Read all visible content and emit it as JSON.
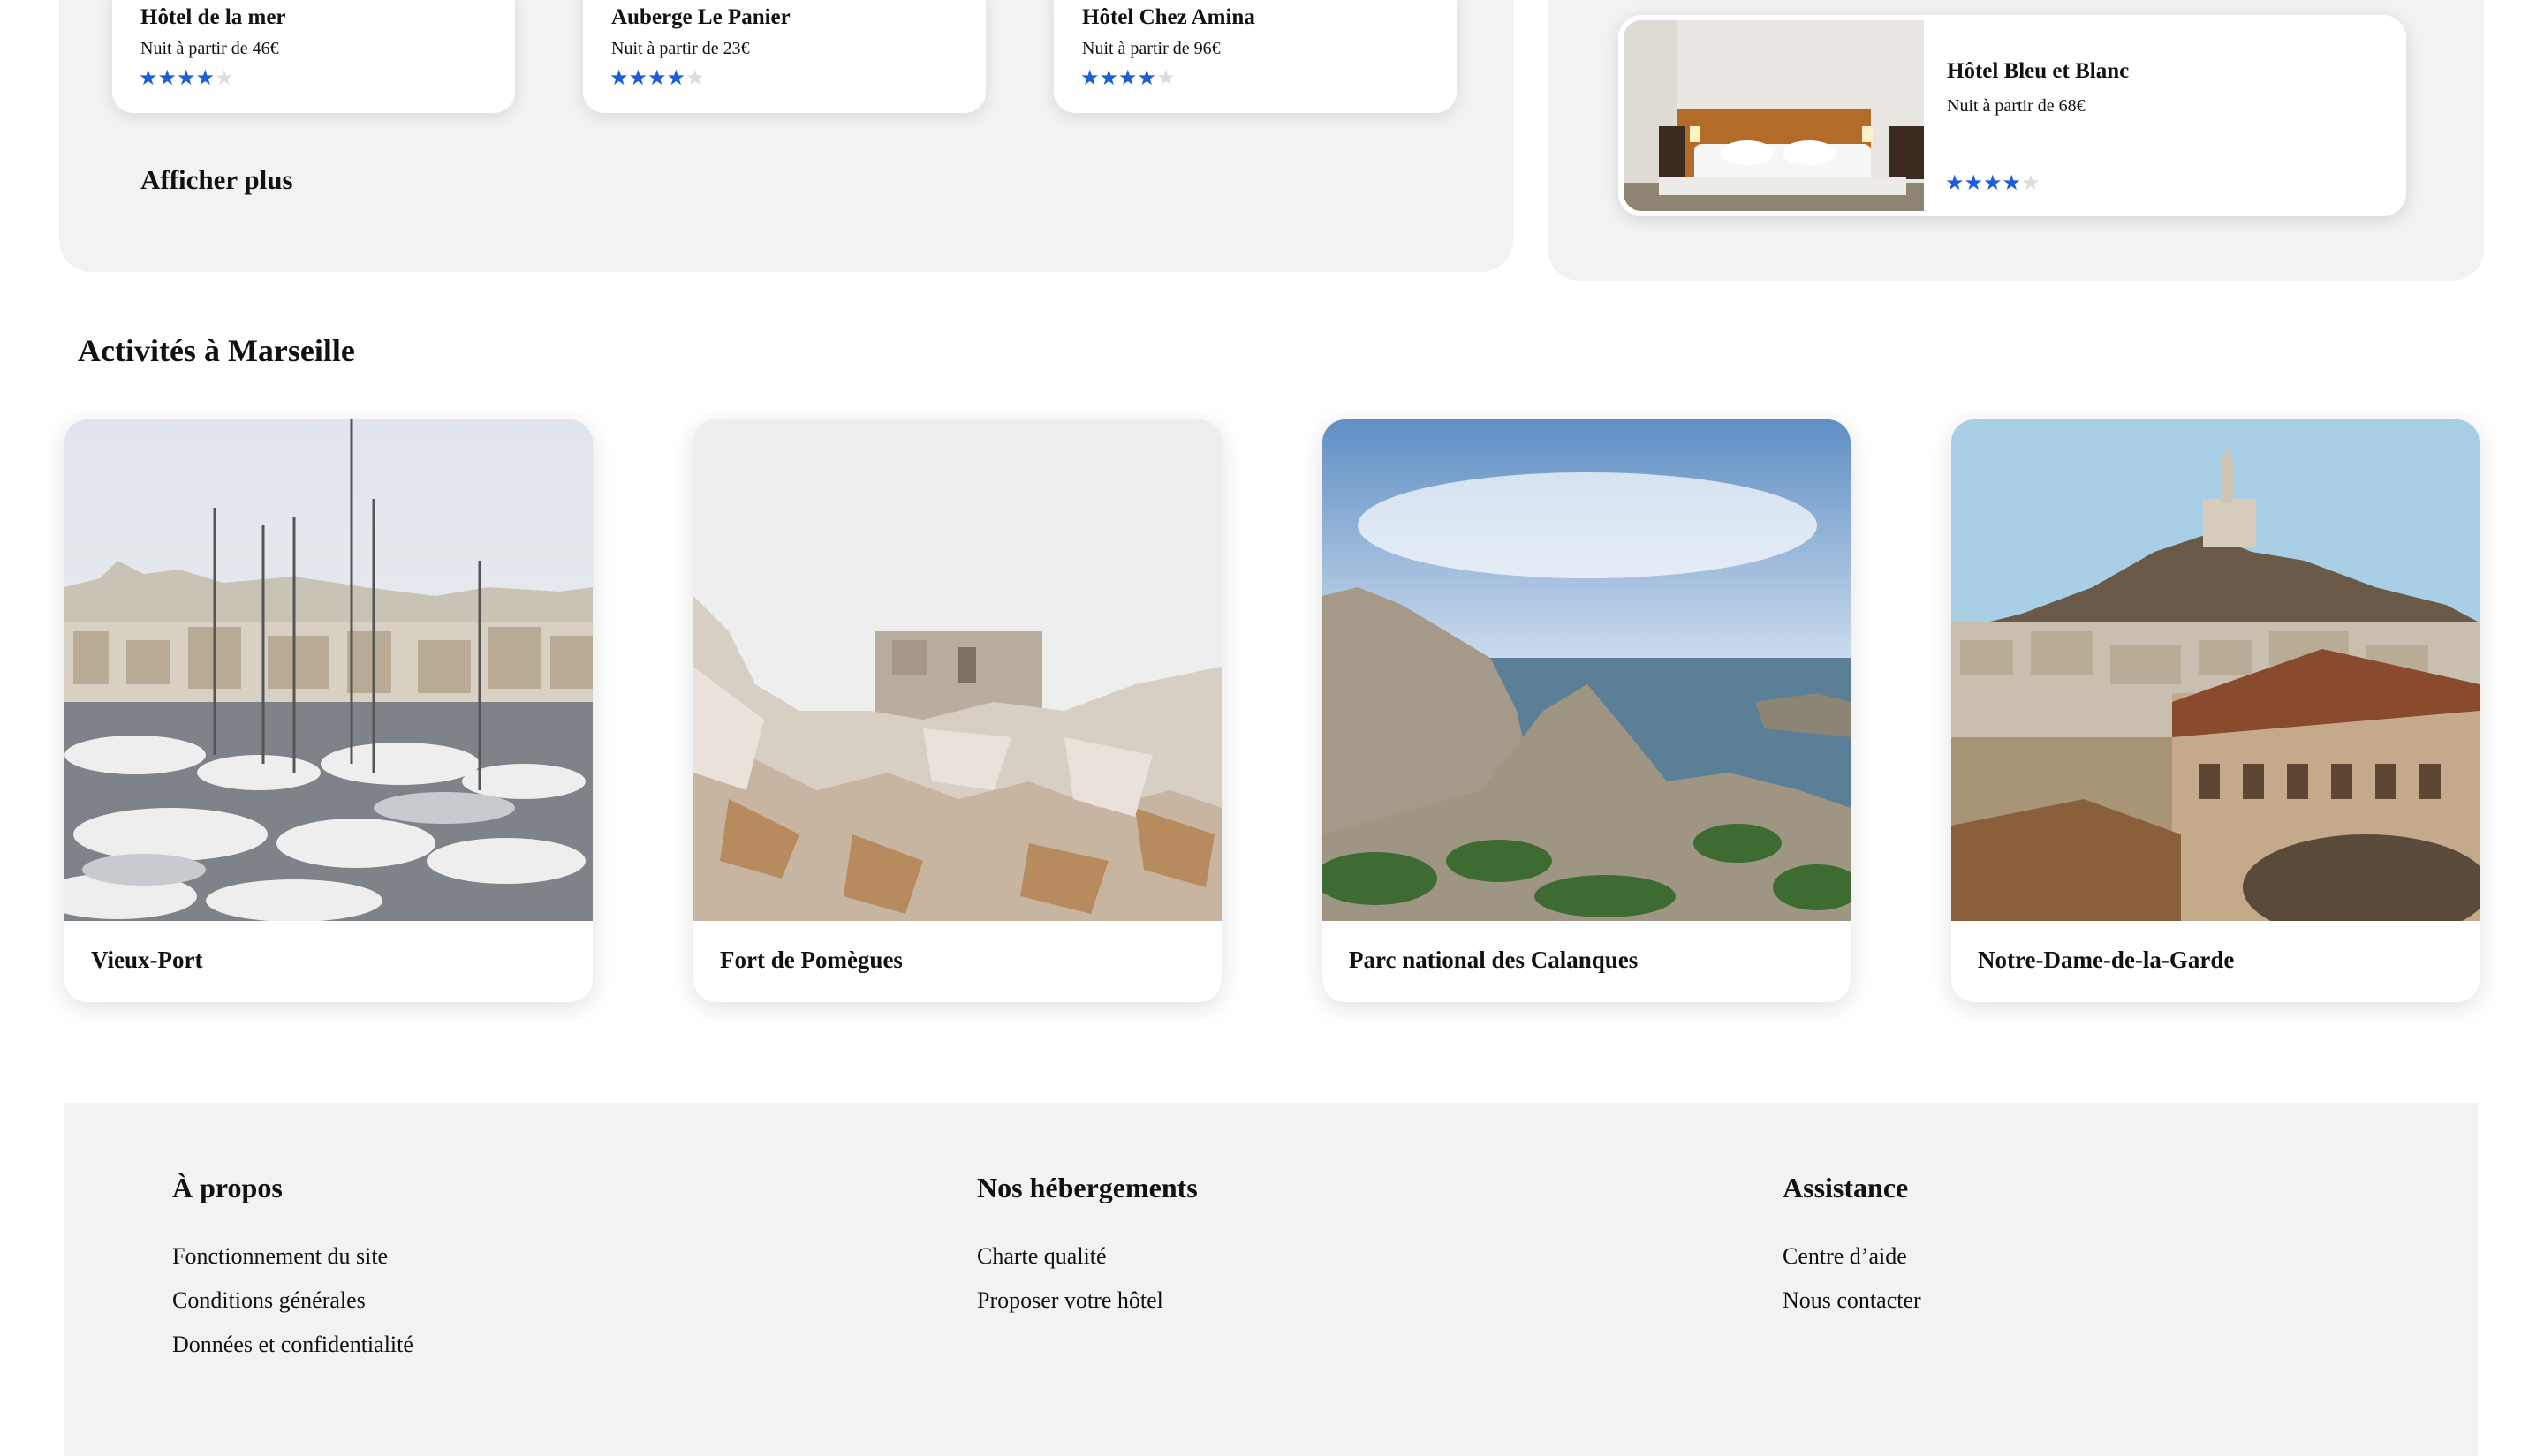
{
  "hotels": [
    {
      "name": "Hôtel de la mer",
      "price": "Nuit à partir de 46€",
      "rating": 4,
      "max": 5
    },
    {
      "name": "Auberge Le Panier",
      "price": "Nuit à partir de 23€",
      "rating": 4,
      "max": 5
    },
    {
      "name": "Hôtel Chez Amina",
      "price": "Nuit à partir de 96€",
      "rating": 4,
      "max": 5
    }
  ],
  "show_more_label": "Afficher plus",
  "featured": {
    "name": "Hôtel Bleu et Blanc",
    "price": "Nuit à partir de 68€",
    "rating": 4,
    "max": 5
  },
  "activities_title": "Activités à Marseille",
  "activities": [
    {
      "label": "Vieux-Port"
    },
    {
      "label": "Fort de Pomègues"
    },
    {
      "label": "Parc national des Calanques"
    },
    {
      "label": "Notre-Dame-de-la-Garde"
    }
  ],
  "footer": {
    "about": {
      "title": "À propos",
      "links": [
        "Fonctionnement du site",
        "Conditions générales",
        "Données et confidentialité"
      ]
    },
    "stays": {
      "title": "Nos hébergements",
      "links": [
        "Charte qualité",
        "Proposer votre hôtel"
      ]
    },
    "help": {
      "title": "Assistance",
      "links": [
        "Centre d’aide",
        "Nous contacter"
      ]
    }
  },
  "colors": {
    "star_on": "#1a5fd8",
    "star_off": "#dcdcdc",
    "panel_bg": "#f2f2f2"
  }
}
